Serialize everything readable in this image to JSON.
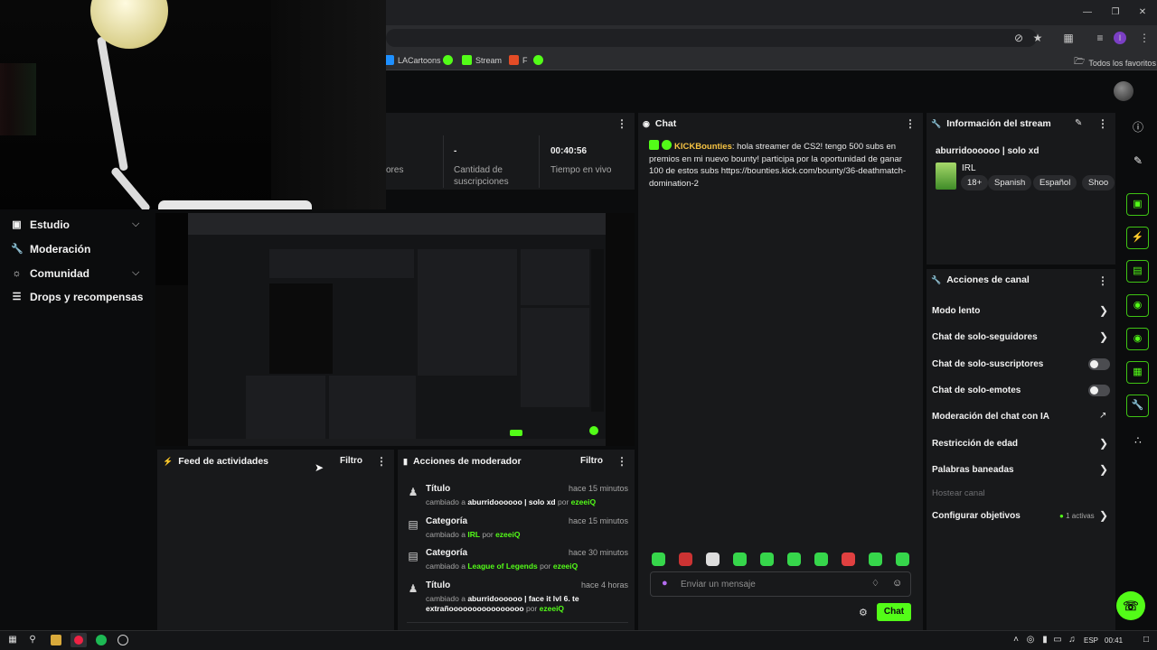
{
  "bookmarks": [
    {
      "label": "LACartoons",
      "color": "#1e90ff"
    },
    {
      "label": "",
      "color": "#53fc18"
    },
    {
      "label": "Stream",
      "color": "#53fc18"
    },
    {
      "label": "F",
      "color": "#e34c26"
    },
    {
      "label": "",
      "color": "#53fc18"
    }
  ],
  "bookmarks_right": "Todos los favoritos",
  "sidebar": {
    "items": [
      {
        "label": "Estudio",
        "icon": "studio-icon",
        "expandable": true
      },
      {
        "label": "Moderación",
        "icon": "wrench-icon",
        "expandable": false
      },
      {
        "label": "Comunidad",
        "icon": "community-icon",
        "expandable": true
      },
      {
        "label": "Drops y recompensas",
        "icon": "drops-icon",
        "expandable": false
      }
    ]
  },
  "stats": {
    "partial_label": "ores",
    "subs_value": "-",
    "subs_label_1": "Cantidad de",
    "subs_label_2": "suscripciones",
    "live_value": "00:40:56",
    "live_label": "Tiempo en vivo"
  },
  "activity": {
    "title": "Feed de actividades",
    "filter": "Filtro"
  },
  "mod_actions": {
    "title": "Acciones de moderador",
    "filter": "Filtro",
    "items": [
      {
        "title": "Título",
        "time": "hace 15 minutos",
        "prefix": "cambiado a",
        "value": "aburridoooooo | solo xd",
        "by": "por",
        "user": "ezeeiQ",
        "icon": "user-edit-icon",
        "value_green": false
      },
      {
        "title": "Categoría",
        "time": "hace 15 minutos",
        "prefix": "cambiado a",
        "value": "IRL",
        "by": "por",
        "user": "ezeeiQ",
        "icon": "category-icon",
        "value_green": true
      },
      {
        "title": "Categoría",
        "time": "hace 30 minutos",
        "prefix": "cambiado a",
        "value": "League of Legends",
        "by": "por",
        "user": "ezeeiQ",
        "icon": "category-icon",
        "value_green": true
      },
      {
        "title": "Título",
        "time": "hace 4 horas",
        "prefix": "cambiado a",
        "value": "aburridoooooo | face it lvl 6. te extrañoooooooooooooooo",
        "by": "por",
        "user": "ezeeiQ",
        "icon": "user-edit-icon",
        "value_green": false
      }
    ]
  },
  "chat": {
    "title": "Chat",
    "message": {
      "user": "KICKBounties",
      "text": ": hola streamer de CS2! tengo 500 subs en premios en mi nuevo bounty! participa por la oportunidad de ganar 100 de estos subs https://bounties.kick.com/bounty/36-deathmatch-domination-2"
    },
    "input_placeholder": "Enviar un mensaje",
    "send_label": "Chat"
  },
  "stream_info": {
    "title": "Información del stream",
    "stream_title": "aburridoooooo | solo xd",
    "category": "IRL",
    "tags": [
      "18+",
      "Spanish",
      "Español",
      "Shoo"
    ]
  },
  "channel_actions": {
    "title": "Acciones de canal",
    "items": [
      {
        "label": "Modo lento",
        "control": "chevron"
      },
      {
        "label": "Chat de solo-seguidores",
        "control": "chevron"
      },
      {
        "label": "Chat de solo-suscriptores",
        "control": "toggle"
      },
      {
        "label": "Chat de solo-emotes",
        "control": "toggle"
      },
      {
        "label": "Moderación del chat con IA",
        "control": "external"
      },
      {
        "label": "Restricción de edad",
        "control": "chevron"
      },
      {
        "label": "Palabras baneadas",
        "control": "chevron"
      },
      {
        "label": "Hostear canal",
        "control": "none",
        "disabled": true
      },
      {
        "label": "Configurar objetivos",
        "control": "chevron",
        "badge": "1 activas"
      }
    ]
  },
  "taskbar": {
    "lang": "ESP",
    "time": "00:41"
  },
  "colors": {
    "accent": "#53fc18",
    "panel": "#18191b",
    "background": "#0b0c0d",
    "username": "#f6c343"
  }
}
